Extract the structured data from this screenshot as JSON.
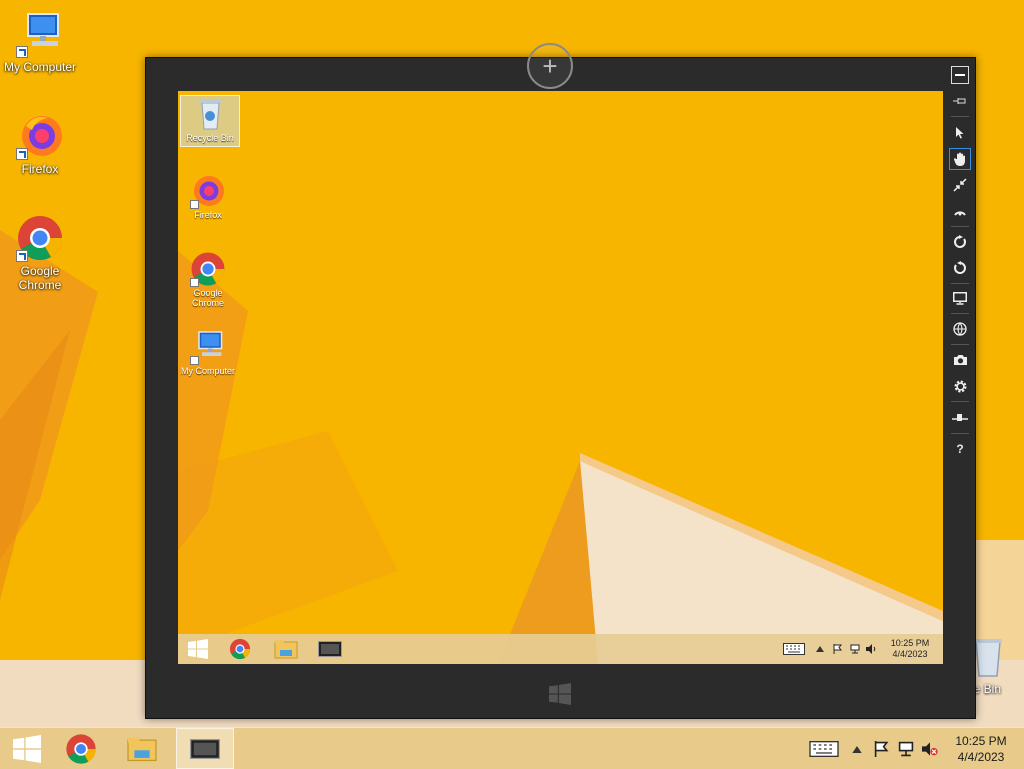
{
  "desktop": {
    "icons": [
      {
        "label": "My Computer",
        "icon": "computer-icon"
      },
      {
        "label": "Firefox",
        "icon": "firefox-icon"
      },
      {
        "label": "Google Chrome",
        "icon": "chrome-icon"
      },
      {
        "label": "le Bin",
        "icon": "recycle-bin-icon"
      }
    ]
  },
  "taskbar": {
    "items": [
      "start-icon",
      "chrome-icon",
      "file-explorer-icon",
      "remote-viewer-icon"
    ],
    "clock": {
      "time": "10:25 PM",
      "date": "4/4/2023"
    },
    "tray": [
      "keyboard-icon",
      "show-hidden-icon",
      "action-center-flag-icon",
      "network-icon",
      "volume-muted-icon"
    ]
  },
  "viewer": {
    "toolbar": [
      {
        "name": "minimize",
        "icon": "minimize-icon"
      },
      {
        "name": "pin",
        "icon": "pin-icon"
      },
      {
        "name": "pointer",
        "icon": "pointer-icon"
      },
      {
        "name": "hand",
        "icon": "hand-icon",
        "selected": true
      },
      {
        "name": "fit",
        "icon": "shrink-icon"
      },
      {
        "name": "scale",
        "icon": "scale-icon"
      },
      {
        "name": "rotate-cw",
        "icon": "rotate-cw-icon"
      },
      {
        "name": "rotate-ccw",
        "icon": "rotate-ccw-icon"
      },
      {
        "name": "display",
        "icon": "monitor-icon"
      },
      {
        "name": "web",
        "icon": "globe-icon"
      },
      {
        "name": "screenshot",
        "icon": "camera-icon"
      },
      {
        "name": "settings",
        "icon": "gear-icon"
      },
      {
        "name": "adjust",
        "icon": "slider-icon"
      },
      {
        "name": "help",
        "icon": "help-icon"
      }
    ],
    "help_glyph": "?",
    "remote": {
      "icons": [
        {
          "label": "Recycle Bin",
          "icon": "recycle-bin-icon"
        },
        {
          "label": "Firefox",
          "icon": "firefox-icon"
        },
        {
          "label": "Google Chrome",
          "icon": "chrome-icon"
        },
        {
          "label": "My Computer",
          "icon": "computer-icon"
        }
      ],
      "taskbar": {
        "clock": {
          "time": "10:25 PM",
          "date": "4/4/2023"
        }
      }
    }
  },
  "colors": {
    "wallpaper": "#f7b400",
    "viewer_frame": "#2b2b2b",
    "selected_tool": "#3b8de0"
  }
}
